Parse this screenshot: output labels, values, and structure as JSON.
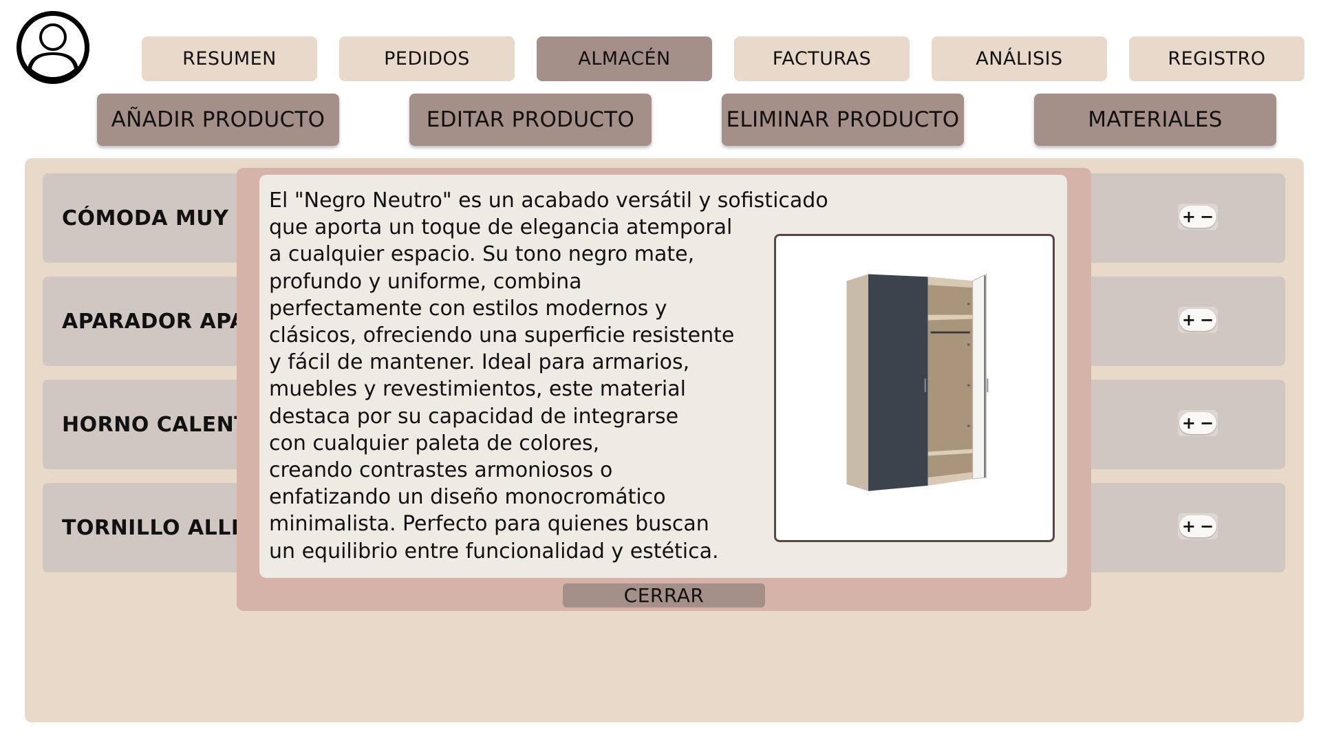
{
  "nav": {
    "tabs": [
      {
        "label": "RESUMEN",
        "active": false
      },
      {
        "label": "PEDIDOS",
        "active": false
      },
      {
        "label": "ALMACÉN",
        "active": true
      },
      {
        "label": "FACTURAS",
        "active": false
      },
      {
        "label": "ANÁLISIS",
        "active": false
      },
      {
        "label": "REGISTRO",
        "active": false
      }
    ]
  },
  "actions": [
    {
      "label": "AÑADIR PRODUCTO"
    },
    {
      "label": "EDITAR PRODUCTO"
    },
    {
      "label": "ELIMINAR PRODUCTO"
    },
    {
      "label": "MATERIALES"
    }
  ],
  "products": [
    {
      "name": "CÓMODA MUY G"
    },
    {
      "name": "APARADOR APA"
    },
    {
      "name": "HORNO CALENT"
    },
    {
      "name": "TORNILLO ALLE"
    }
  ],
  "stepper": {
    "plus": "+",
    "minus": "−"
  },
  "modal": {
    "lines": [
      "El \"Negro Neutro\" es un acabado versátil y sofisticado",
      "que aporta un toque de elegancia atemporal",
      "a cualquier espacio. Su tono negro mate,",
      "profundo y uniforme, combina",
      "perfectamente con estilos modernos y",
      "clásicos, ofreciendo una superficie resistente",
      "y fácil de mantener. Ideal para armarios,",
      "muebles y revestimientos, este material",
      "destaca por su capacidad de integrarse",
      "con cualquier paleta de colores,",
      "creando contrastes armoniosos o",
      "enfatizando un diseño monocromático",
      "minimalista. Perfecto para quienes buscan",
      "un equilibrio entre funcionalidad y estética."
    ],
    "image_icon": "wardrobe-image",
    "close_label": "CERRAR"
  },
  "colors": {
    "panel": "#e8d9c9",
    "tab": "#e9d9ca",
    "active": "#a49088",
    "row": "#d0c7c3",
    "modal": "#d5b3a9",
    "modal_inner": "#eeeae4"
  }
}
